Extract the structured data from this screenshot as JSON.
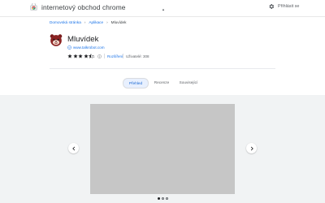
{
  "header": {
    "store_title": "internetový obchod chrome",
    "signin_label": "Přihlásit se",
    "icons": {
      "logo": "chrome-web-store-logo",
      "settings": "gear-icon"
    }
  },
  "breadcrumb": {
    "home": "Domovská stránka",
    "apps": "Aplikace",
    "current": "Mluvídek",
    "separator": "›"
  },
  "extension": {
    "name": "Mluvídek",
    "website": "www.talkrobot.com",
    "rating": 4.5,
    "rating_max": 5,
    "rating_count": "1",
    "category": "Rozšíření",
    "users": "Uživatelé: 308"
  },
  "tabs": [
    {
      "label": "Přehled",
      "active": true
    },
    {
      "label": "Recenze",
      "active": false
    },
    {
      "label": "Související",
      "active": false
    }
  ],
  "gallery": {
    "slide_count": 3,
    "active_index": 0
  },
  "colors": {
    "accent": "#1a73e8",
    "star": "#202124",
    "gallery_bg": "#f1f3f4",
    "screenshot_placeholder": "#c6c6c6"
  }
}
